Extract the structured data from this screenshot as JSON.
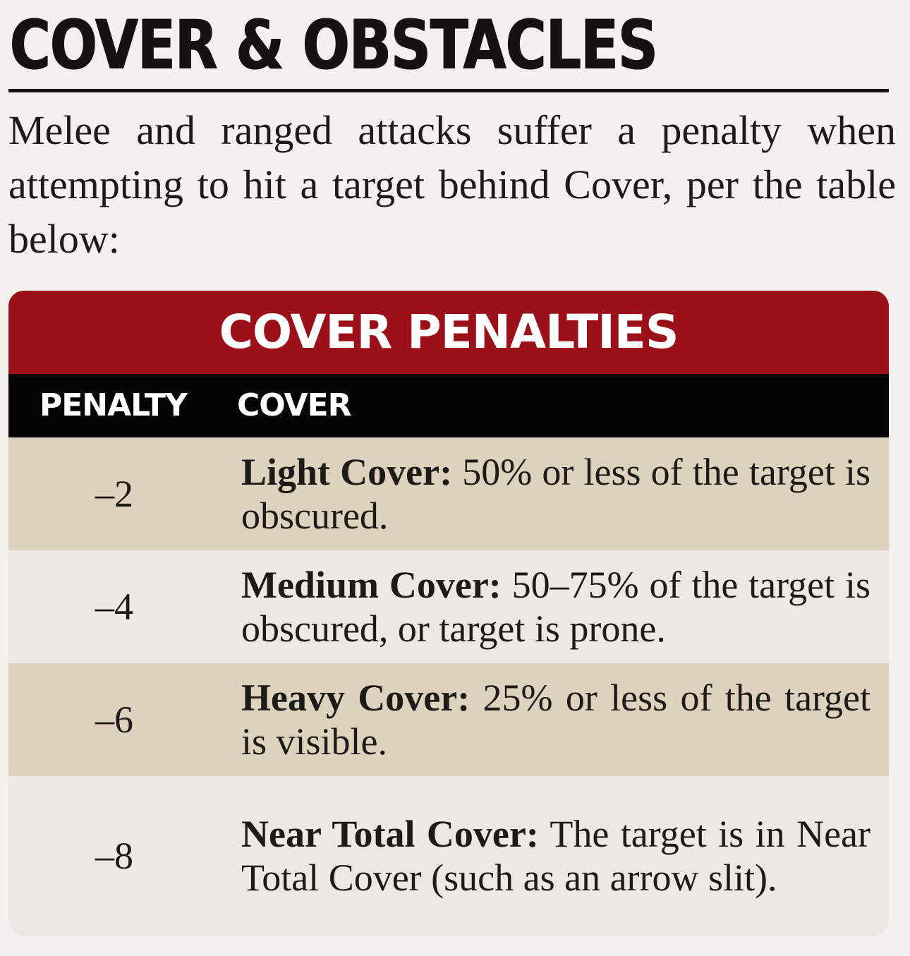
{
  "section": {
    "title": "COVER & OBSTACLES",
    "intro": "Melee and ranged attacks suffer a penalty when attempting to hit a target behind Cover, per the table below:"
  },
  "table": {
    "title": "COVER PENALTIES",
    "columns": {
      "penalty": "PENALTY",
      "cover": "COVER"
    },
    "rows": [
      {
        "penalty": "–2",
        "name": "Light Cover:",
        "description": "50% or less of the target is obscured."
      },
      {
        "penalty": "–4",
        "name": "Medium Cover:",
        "description": "50–75% of the target is obscured, or target is prone."
      },
      {
        "penalty": "–6",
        "name": "Heavy Cover:",
        "description": "25% or less of the target is visible."
      },
      {
        "penalty": "–8",
        "name": "Near Total Cover:",
        "description": "The target is in Near Total Cover (such as an arrow slit)."
      }
    ]
  },
  "colors": {
    "title_bar": "#9c1119",
    "header_bar": "#050505",
    "row_shaded": "#dcd2bd",
    "row_plain": "#ece9e4",
    "page_background": "#f3f1ee"
  }
}
